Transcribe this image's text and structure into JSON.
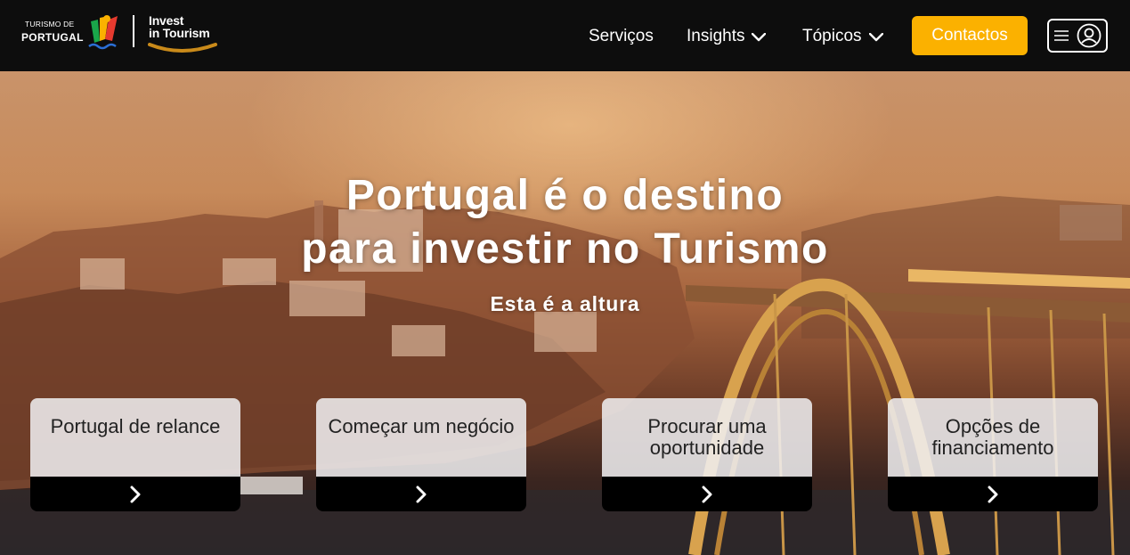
{
  "header": {
    "logo_tp_line1": "TURISMO DE",
    "logo_tp_line2": "PORTUGAL",
    "logo_iit_line1": "Invest",
    "logo_iit_line2": "in Tourism",
    "nav": [
      {
        "label": "Serviços",
        "has_dropdown": false
      },
      {
        "label": "Insights",
        "has_dropdown": true
      },
      {
        "label": "Tópicos",
        "has_dropdown": true
      }
    ],
    "contact_label": "Contactos",
    "menu_icons": [
      "hamburger-icon",
      "user-icon"
    ]
  },
  "hero": {
    "title_line1": "Portugal é o destino",
    "title_line2": "para investir no Turismo",
    "subtitle": "Esta é a altura"
  },
  "cards": [
    {
      "label": "Portugal de relance",
      "icon": "chevron-right-icon"
    },
    {
      "label": "Começar um negócio",
      "icon": "chevron-right-icon"
    },
    {
      "label": "Procurar uma oportunidade",
      "icon": "chevron-right-icon"
    },
    {
      "label": "Opções de financiamento",
      "icon": "chevron-right-icon"
    }
  ],
  "colors": {
    "header_bg": "#0d0d0d",
    "accent": "#fbb100",
    "card_bg": "#f0f0f2",
    "card_footer": "#000000"
  }
}
